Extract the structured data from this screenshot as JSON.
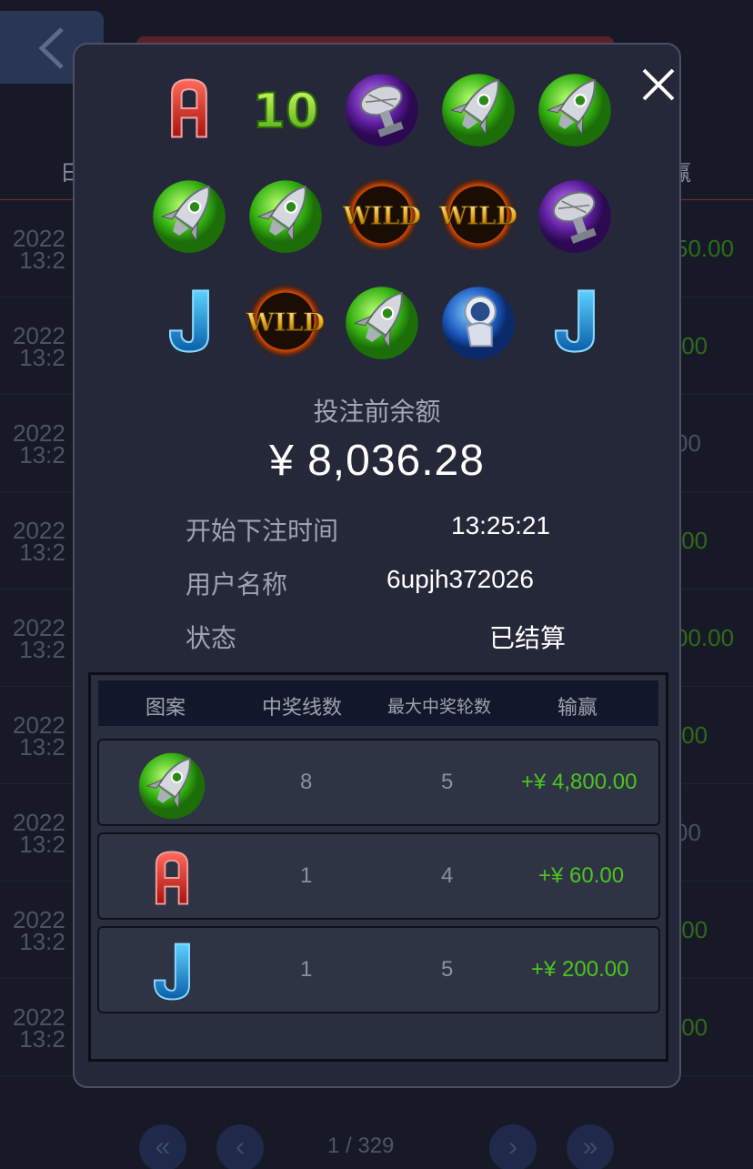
{
  "background": {
    "pager_text": "1 / 329"
  },
  "modal": {
    "close_label": "×",
    "grid": [
      [
        "A-icon",
        "10-icon",
        "satellite-icon",
        "rocket-icon",
        "rocket-icon"
      ],
      [
        "rocket-icon",
        "rocket-icon",
        "wild-icon",
        "wild-icon",
        "satellite-icon"
      ],
      [
        "J-icon",
        "wild-icon",
        "rocket-icon",
        "astronaut-icon",
        "J-icon"
      ]
    ],
    "balance_title": "投注前余额",
    "balance_value": "¥ 8,036.28",
    "info": [
      {
        "label": "开始下注时间",
        "value": "13:25:21"
      },
      {
        "label": "用户名称",
        "value": "6upjh372026"
      },
      {
        "label": "状态",
        "value": "已结算"
      }
    ],
    "table": {
      "headers": [
        "图案",
        "中奖线数",
        "最大中奖轮数",
        "输赢"
      ],
      "rows": [
        {
          "symbol": "rocket-icon",
          "lines": "8",
          "reels": "5",
          "win": "+¥ 4,800.00"
        },
        {
          "symbol": "A-icon",
          "lines": "1",
          "reels": "4",
          "win": "+¥ 60.00"
        },
        {
          "symbol": "J-icon",
          "lines": "1",
          "reels": "5",
          "win": "+¥ 200.00"
        }
      ]
    }
  },
  "colors": {
    "win_green": "#4cc41e",
    "modal_bg": "#242838"
  }
}
